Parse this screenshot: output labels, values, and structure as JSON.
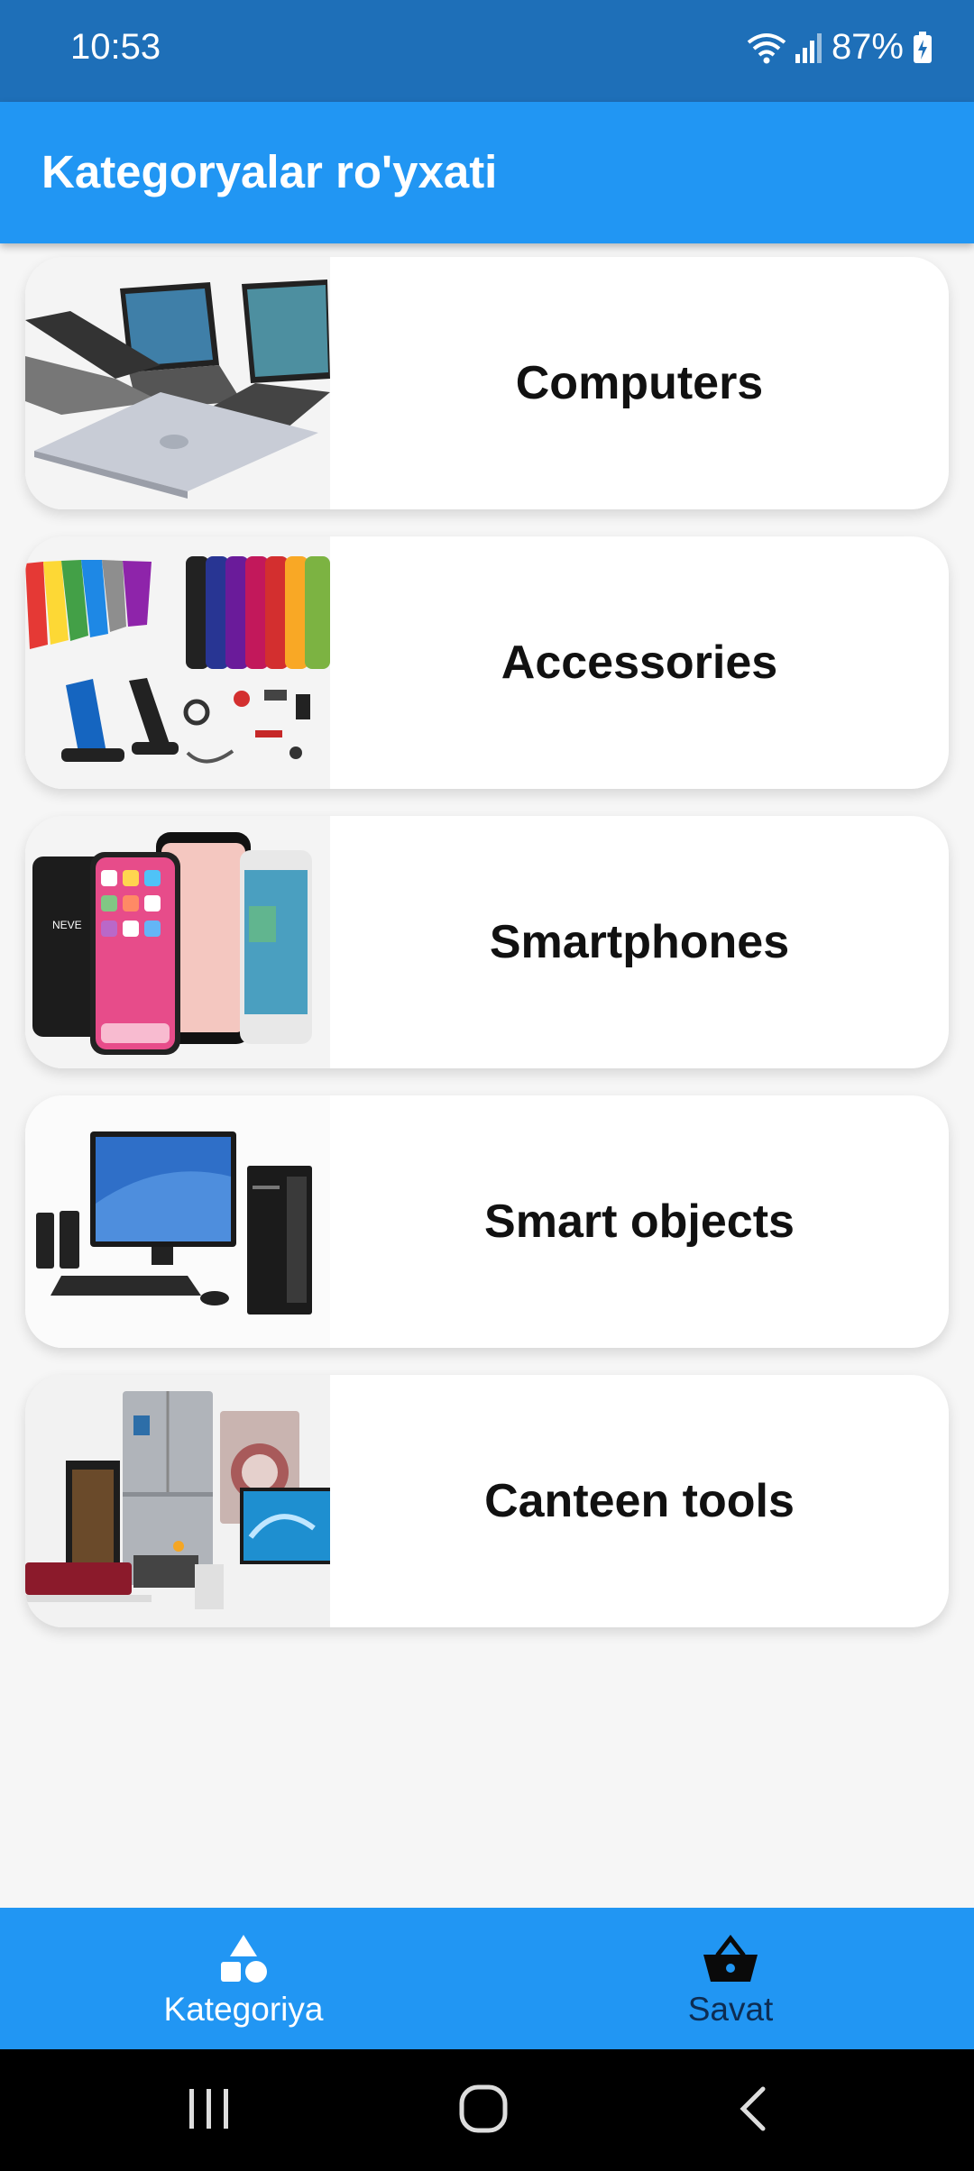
{
  "status": {
    "time": "10:53",
    "battery": "87%"
  },
  "app_bar": {
    "title": "Kategoryalar ro'yxati"
  },
  "categories": [
    {
      "label": "Computers",
      "icon": "laptops-image"
    },
    {
      "label": "Accessories",
      "icon": "accessories-image"
    },
    {
      "label": "Smartphones",
      "icon": "smartphones-image"
    },
    {
      "label": "Smart objects",
      "icon": "desktop-pc-image"
    },
    {
      "label": "Canteen tools",
      "icon": "appliances-image"
    }
  ],
  "bottom_nav": {
    "items": [
      {
        "label": "Kategoriya",
        "icon": "shapes-icon",
        "active": true
      },
      {
        "label": "Savat",
        "icon": "basket-icon",
        "active": false
      }
    ]
  },
  "colors": {
    "status_bar": "#1e6fb8",
    "primary": "#2196f3",
    "inactive_nav": "#0d2c52"
  }
}
